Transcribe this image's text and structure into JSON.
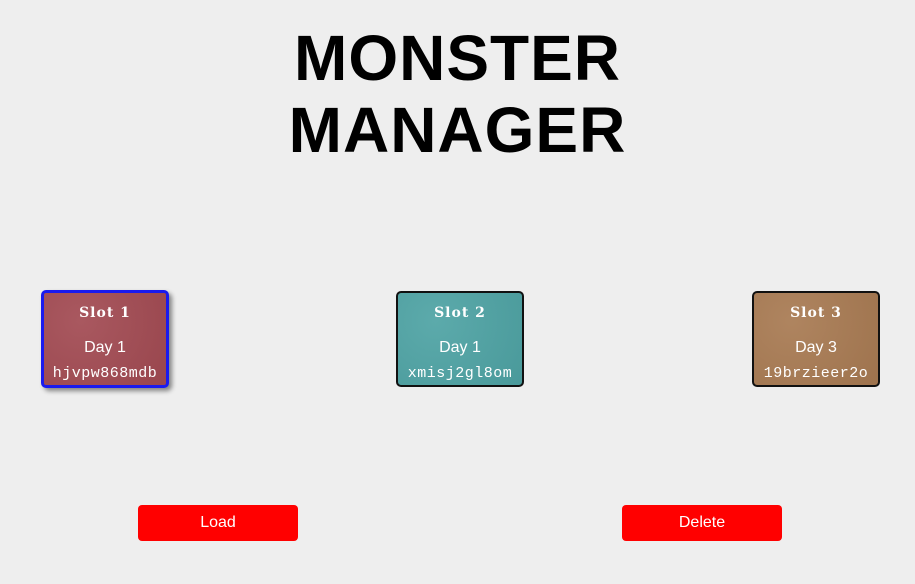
{
  "title": {
    "line1": "MONSTER",
    "line2": "MANAGER"
  },
  "slots": [
    {
      "name": "Slot 1",
      "day": "Day 1",
      "seed": "hjvpw868mdb",
      "color": "#a24a52",
      "selected": true
    },
    {
      "name": "Slot 2",
      "day": "Day 1",
      "seed": "xmisj2gl8om",
      "color": "#4ea3a4",
      "selected": false
    },
    {
      "name": "Slot 3",
      "day": "Day 3",
      "seed": "19brzieer2o",
      "color": "#a87a52",
      "selected": false
    }
  ],
  "buttons": {
    "load_label": "Load",
    "delete_label": "Delete",
    "color": "#ff0000"
  },
  "colors": {
    "background": "#eeeeee",
    "selected_border": "#1a1aee"
  }
}
